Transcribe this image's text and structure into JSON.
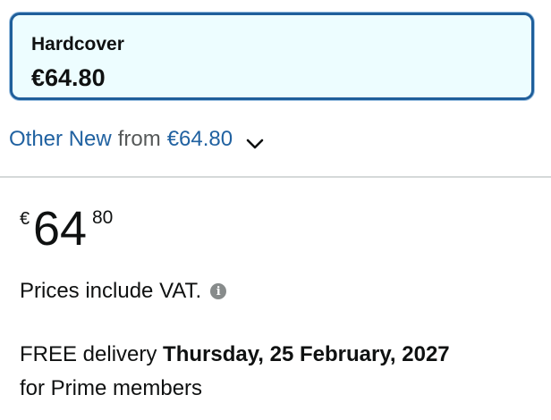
{
  "format": {
    "name": "Hardcover",
    "price": "€64.80"
  },
  "other_offers": {
    "link_label": "Other New",
    "from_label": "from",
    "price": "€64.80",
    "chevron_icon": "chevron-down-icon"
  },
  "price": {
    "symbol": "€",
    "whole": "64",
    "fraction": "80"
  },
  "vat": {
    "text": "Prices include VAT.",
    "icon": "info-icon",
    "icon_glyph": "i"
  },
  "delivery": {
    "prefix": "FREE delivery",
    "date": "Thursday, 25 February, 2027",
    "suffix": "for Prime members"
  },
  "colors": {
    "link": "#2162a1",
    "selected_border": "#1f5f9b",
    "selected_bg": "#edfdff",
    "text": "#0f1111",
    "muted": "#565959",
    "divider": "#d5d9d9"
  }
}
